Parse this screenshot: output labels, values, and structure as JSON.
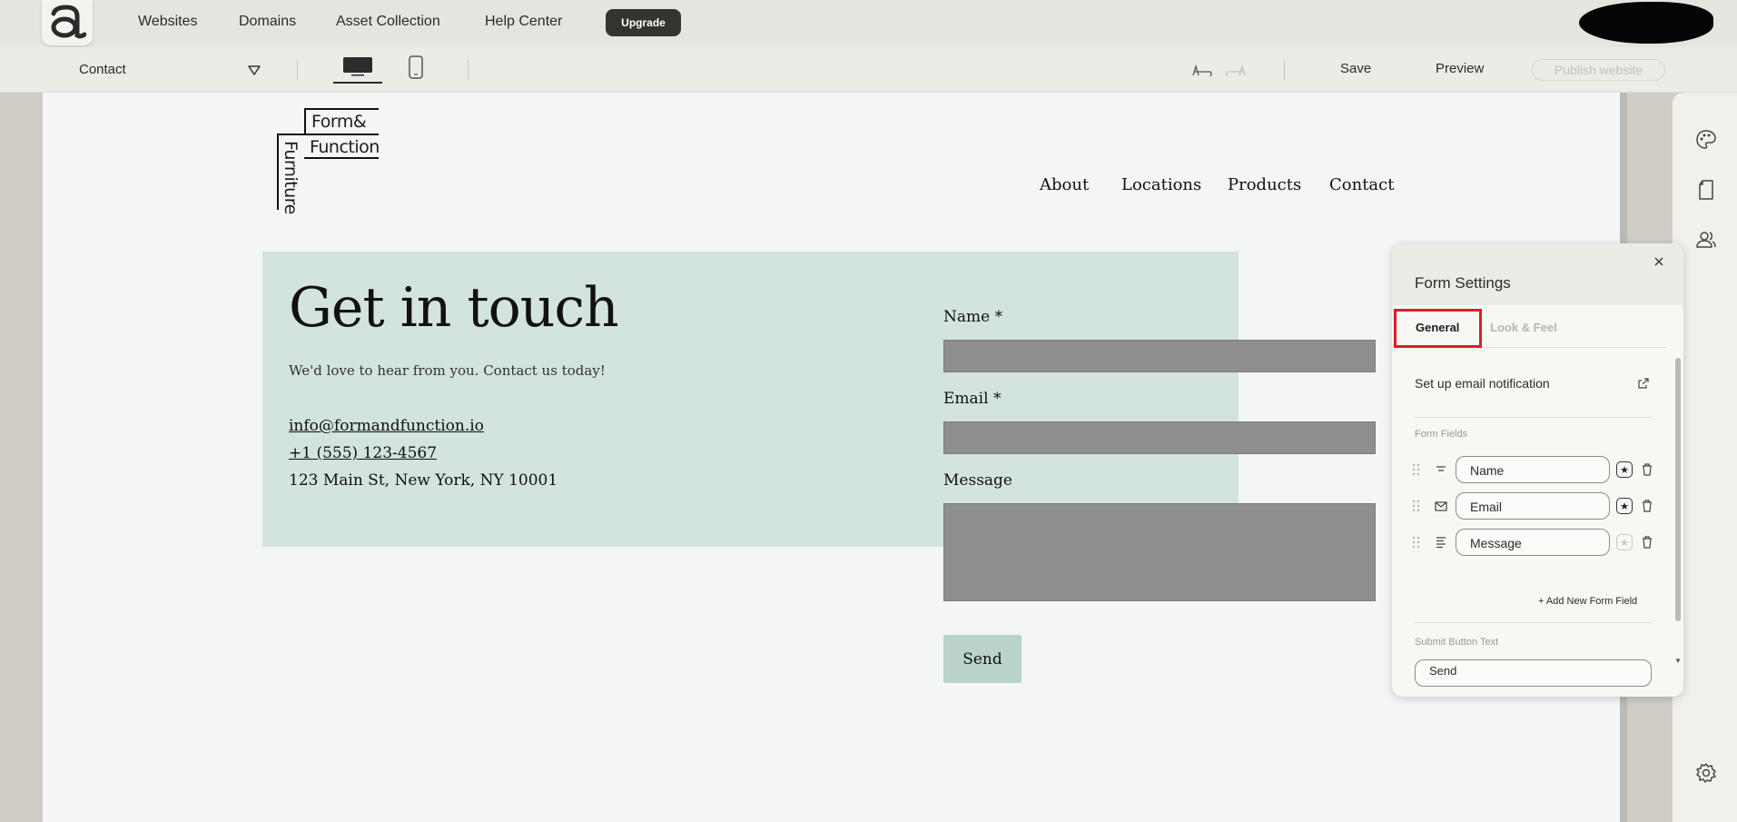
{
  "topnav": {
    "logo_icon": "brand-a-logo-icon",
    "links": [
      "Websites",
      "Domains",
      "Asset Collection",
      "Help Center"
    ],
    "upgrade_label": "Upgrade"
  },
  "toolbar": {
    "page_name": "Contact",
    "save_label": "Save",
    "preview_label": "Preview",
    "publish_label": "Publish website"
  },
  "site": {
    "logo": {
      "line1": "Form&",
      "line2": "Function",
      "line3": "Furniture"
    },
    "nav": [
      "About",
      "Locations",
      "Products",
      "Contact"
    ],
    "hero": {
      "title": "Get in touch",
      "subtitle": "We'd love to hear from you. Contact us today!",
      "email": "info@formandfunction.io",
      "phone": "+1 (555) 123-4567",
      "address": "123 Main St, New York, NY 10001"
    },
    "form": {
      "name_label": "Name *",
      "email_label": "Email *",
      "message_label": "Message",
      "send_label": "Send"
    }
  },
  "panel": {
    "title": "Form Settings",
    "tabs": [
      {
        "label": "General",
        "active": true
      },
      {
        "label": "Look & Feel",
        "active": false
      }
    ],
    "email_notification": "Set up email notification",
    "form_fields_label": "Form Fields",
    "fields": [
      {
        "name": "Name",
        "type_icon": "short-text-icon",
        "required": true
      },
      {
        "name": "Email",
        "type_icon": "envelope-icon",
        "required": true
      },
      {
        "name": "Message",
        "type_icon": "paragraph-icon",
        "required": false
      }
    ],
    "add_field_label": "+ Add New Form Field",
    "submit_label": "Submit Button Text",
    "submit_value": "Send"
  },
  "colors": {
    "hero_bg": "#d3e3dd",
    "send_bg": "#b9d3ca",
    "highlight": "#e01b24",
    "upgrade_bg": "#33332f"
  }
}
